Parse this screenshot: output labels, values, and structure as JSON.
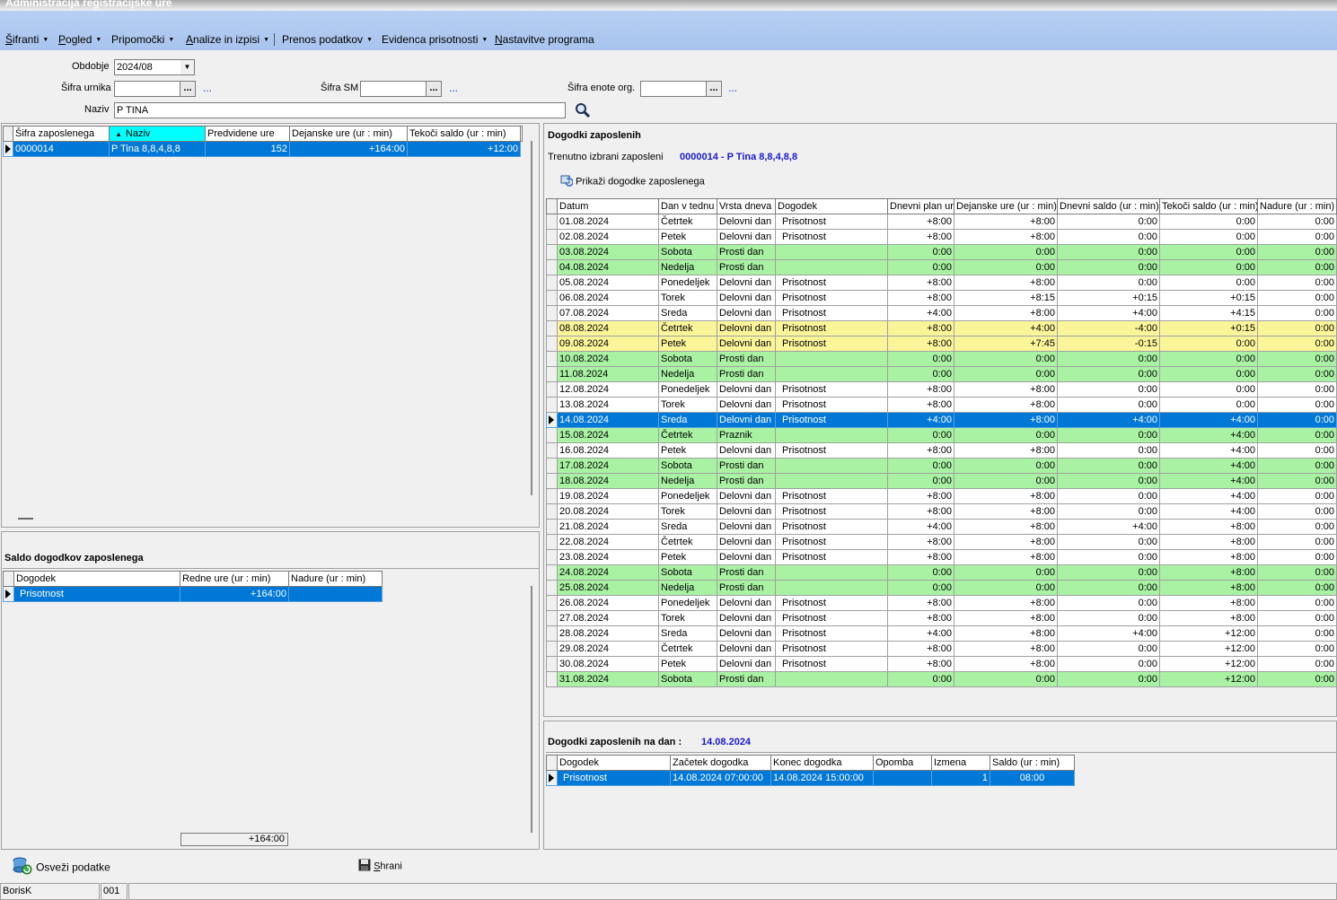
{
  "window": {
    "title": "Administracija registracijske ure"
  },
  "menu": [
    {
      "label": "Šifranti",
      "underline": "Š",
      "rest": "ifranti",
      "dropdown": true
    },
    {
      "label": "Pogled",
      "underline": "P",
      "rest": "ogled",
      "dropdown": true
    },
    {
      "label": "Pripomočki",
      "underline": "",
      "rest": "Pripomočki",
      "dropdown": true
    },
    {
      "label": "Analize in izpisi",
      "underline": "A",
      "rest": "nalize in izpisi",
      "dropdown": true
    },
    {
      "label": "Prenos podatkov",
      "underline": "",
      "rest": "Prenos podatkov",
      "dropdown": true
    },
    {
      "label": "Evidenca prisotnosti",
      "underline": "",
      "rest": "Evidenca prisotnosti",
      "dropdown": true
    },
    {
      "label": "Nastavitve programa",
      "underline": "N",
      "rest": "astavitve programa",
      "dropdown": false
    }
  ],
  "filters": {
    "obdobje_label": "Obdobje",
    "obdobje_value": "2024/08",
    "sifra_urnika_label": "Šifra urnika",
    "sifra_urnika_value": "",
    "sifra_sm_label": "Šifra SM",
    "sifra_sm_value": "",
    "sifra_enote_label": "Šifra enote org.",
    "sifra_enote_value": "",
    "naziv_label": "Naziv",
    "naziv_value": "P TINA",
    "ellipsis": "...",
    "more": "..."
  },
  "employees": {
    "columns": [
      "Šifra zaposlenega",
      "Naziv",
      "Predvidene ure",
      "Dejanske ure (ur : min)",
      "Tekoči saldo (ur : min)"
    ],
    "rows": [
      {
        "sifra": "0000014",
        "naziv": "P Tina 8,8,4,8,8",
        "predvidene": "152",
        "dejanske": "+164:00",
        "saldo": "+12:00"
      }
    ]
  },
  "saldo": {
    "title": "Saldo dogodkov zaposlenega",
    "columns": [
      "Dogodek",
      "Redne ure (ur : min)",
      "Nadure (ur : min)"
    ],
    "rows": [
      {
        "dogodek": "Prisotnost",
        "redne": "+164:00",
        "nadure": ""
      }
    ],
    "total": "+164:00"
  },
  "events": {
    "title": "Dogodki zaposlenih",
    "current_label": "Trenutno izbrani zaposleni",
    "current_value": "0000014 - P Tina 8,8,4,8,8",
    "show_button": "Prikaži dogodke zaposlenega",
    "columns": [
      "Datum",
      "Dan v tednu",
      "Vrsta dneva",
      "Dogodek",
      "Dnevni plan ur",
      "Dejanske ure (ur : min)",
      "Dnevni saldo (ur : min)",
      "Tekoči saldo (ur : min)",
      "Nadure (ur : min)"
    ],
    "rows": [
      {
        "datum": "01.08.2024",
        "dan": "Četrtek",
        "vrsta": "Delovni dan",
        "dogodek": "Prisotnost",
        "plan": "+8:00",
        "dejanske": "+8:00",
        "dnevni": "0:00",
        "tekoci": "0:00",
        "nadure": "0:00",
        "color": "white"
      },
      {
        "datum": "02.08.2024",
        "dan": "Petek",
        "vrsta": "Delovni dan",
        "dogodek": "Prisotnost",
        "plan": "+8:00",
        "dejanske": "+8:00",
        "dnevni": "0:00",
        "tekoci": "0:00",
        "nadure": "0:00",
        "color": "white"
      },
      {
        "datum": "03.08.2024",
        "dan": "Sobota",
        "vrsta": "Prosti dan",
        "dogodek": "",
        "plan": "0:00",
        "dejanske": "0:00",
        "dnevni": "0:00",
        "tekoci": "0:00",
        "nadure": "0:00",
        "color": "green"
      },
      {
        "datum": "04.08.2024",
        "dan": "Nedelja",
        "vrsta": "Prosti dan",
        "dogodek": "",
        "plan": "0:00",
        "dejanske": "0:00",
        "dnevni": "0:00",
        "tekoci": "0:00",
        "nadure": "0:00",
        "color": "green"
      },
      {
        "datum": "05.08.2024",
        "dan": "Ponedeljek",
        "vrsta": "Delovni dan",
        "dogodek": "Prisotnost",
        "plan": "+8:00",
        "dejanske": "+8:00",
        "dnevni": "0:00",
        "tekoci": "0:00",
        "nadure": "0:00",
        "color": "white"
      },
      {
        "datum": "06.08.2024",
        "dan": "Torek",
        "vrsta": "Delovni dan",
        "dogodek": "Prisotnost",
        "plan": "+8:00",
        "dejanske": "+8:15",
        "dnevni": "+0:15",
        "tekoci": "+0:15",
        "nadure": "0:00",
        "color": "white"
      },
      {
        "datum": "07.08.2024",
        "dan": "Sreda",
        "vrsta": "Delovni dan",
        "dogodek": "Prisotnost",
        "plan": "+4:00",
        "dejanske": "+8:00",
        "dnevni": "+4:00",
        "tekoci": "+4:15",
        "nadure": "0:00",
        "color": "white"
      },
      {
        "datum": "08.08.2024",
        "dan": "Četrtek",
        "vrsta": "Delovni dan",
        "dogodek": "Prisotnost",
        "plan": "+8:00",
        "dejanske": "+4:00",
        "dnevni": "-4:00",
        "tekoci": "+0:15",
        "nadure": "0:00",
        "color": "yellow"
      },
      {
        "datum": "09.08.2024",
        "dan": "Petek",
        "vrsta": "Delovni dan",
        "dogodek": "Prisotnost",
        "plan": "+8:00",
        "dejanske": "+7:45",
        "dnevni": "-0:15",
        "tekoci": "0:00",
        "nadure": "0:00",
        "color": "yellow"
      },
      {
        "datum": "10.08.2024",
        "dan": "Sobota",
        "vrsta": "Prosti dan",
        "dogodek": "",
        "plan": "0:00",
        "dejanske": "0:00",
        "dnevni": "0:00",
        "tekoci": "0:00",
        "nadure": "0:00",
        "color": "green"
      },
      {
        "datum": "11.08.2024",
        "dan": "Nedelja",
        "vrsta": "Prosti dan",
        "dogodek": "",
        "plan": "0:00",
        "dejanske": "0:00",
        "dnevni": "0:00",
        "tekoci": "0:00",
        "nadure": "0:00",
        "color": "green"
      },
      {
        "datum": "12.08.2024",
        "dan": "Ponedeljek",
        "vrsta": "Delovni dan",
        "dogodek": "Prisotnost",
        "plan": "+8:00",
        "dejanske": "+8:00",
        "dnevni": "0:00",
        "tekoci": "0:00",
        "nadure": "0:00",
        "color": "white"
      },
      {
        "datum": "13.08.2024",
        "dan": "Torek",
        "vrsta": "Delovni dan",
        "dogodek": "Prisotnost",
        "plan": "+8:00",
        "dejanske": "+8:00",
        "dnevni": "0:00",
        "tekoci": "0:00",
        "nadure": "0:00",
        "color": "white"
      },
      {
        "datum": "14.08.2024",
        "dan": "Sreda",
        "vrsta": "Delovni dan",
        "dogodek": "Prisotnost",
        "plan": "+4:00",
        "dejanske": "+8:00",
        "dnevni": "+4:00",
        "tekoci": "+4:00",
        "nadure": "0:00",
        "color": "sel"
      },
      {
        "datum": "15.08.2024",
        "dan": "Četrtek",
        "vrsta": "Praznik",
        "dogodek": "",
        "plan": "0:00",
        "dejanske": "0:00",
        "dnevni": "0:00",
        "tekoci": "+4:00",
        "nadure": "0:00",
        "color": "green"
      },
      {
        "datum": "16.08.2024",
        "dan": "Petek",
        "vrsta": "Delovni dan",
        "dogodek": "Prisotnost",
        "plan": "+8:00",
        "dejanske": "+8:00",
        "dnevni": "0:00",
        "tekoci": "+4:00",
        "nadure": "0:00",
        "color": "white"
      },
      {
        "datum": "17.08.2024",
        "dan": "Sobota",
        "vrsta": "Prosti dan",
        "dogodek": "",
        "plan": "0:00",
        "dejanske": "0:00",
        "dnevni": "0:00",
        "tekoci": "+4:00",
        "nadure": "0:00",
        "color": "green"
      },
      {
        "datum": "18.08.2024",
        "dan": "Nedelja",
        "vrsta": "Prosti dan",
        "dogodek": "",
        "plan": "0:00",
        "dejanske": "0:00",
        "dnevni": "0:00",
        "tekoci": "+4:00",
        "nadure": "0:00",
        "color": "green"
      },
      {
        "datum": "19.08.2024",
        "dan": "Ponedeljek",
        "vrsta": "Delovni dan",
        "dogodek": "Prisotnost",
        "plan": "+8:00",
        "dejanske": "+8:00",
        "dnevni": "0:00",
        "tekoci": "+4:00",
        "nadure": "0:00",
        "color": "white"
      },
      {
        "datum": "20.08.2024",
        "dan": "Torek",
        "vrsta": "Delovni dan",
        "dogodek": "Prisotnost",
        "plan": "+8:00",
        "dejanske": "+8:00",
        "dnevni": "0:00",
        "tekoci": "+4:00",
        "nadure": "0:00",
        "color": "white"
      },
      {
        "datum": "21.08.2024",
        "dan": "Sreda",
        "vrsta": "Delovni dan",
        "dogodek": "Prisotnost",
        "plan": "+4:00",
        "dejanske": "+8:00",
        "dnevni": "+4:00",
        "tekoci": "+8:00",
        "nadure": "0:00",
        "color": "white"
      },
      {
        "datum": "22.08.2024",
        "dan": "Četrtek",
        "vrsta": "Delovni dan",
        "dogodek": "Prisotnost",
        "plan": "+8:00",
        "dejanske": "+8:00",
        "dnevni": "0:00",
        "tekoci": "+8:00",
        "nadure": "0:00",
        "color": "white"
      },
      {
        "datum": "23.08.2024",
        "dan": "Petek",
        "vrsta": "Delovni dan",
        "dogodek": "Prisotnost",
        "plan": "+8:00",
        "dejanske": "+8:00",
        "dnevni": "0:00",
        "tekoci": "+8:00",
        "nadure": "0:00",
        "color": "white"
      },
      {
        "datum": "24.08.2024",
        "dan": "Sobota",
        "vrsta": "Prosti dan",
        "dogodek": "",
        "plan": "0:00",
        "dejanske": "0:00",
        "dnevni": "0:00",
        "tekoci": "+8:00",
        "nadure": "0:00",
        "color": "green"
      },
      {
        "datum": "25.08.2024",
        "dan": "Nedelja",
        "vrsta": "Prosti dan",
        "dogodek": "",
        "plan": "0:00",
        "dejanske": "0:00",
        "dnevni": "0:00",
        "tekoci": "+8:00",
        "nadure": "0:00",
        "color": "green"
      },
      {
        "datum": "26.08.2024",
        "dan": "Ponedeljek",
        "vrsta": "Delovni dan",
        "dogodek": "Prisotnost",
        "plan": "+8:00",
        "dejanske": "+8:00",
        "dnevni": "0:00",
        "tekoci": "+8:00",
        "nadure": "0:00",
        "color": "white"
      },
      {
        "datum": "27.08.2024",
        "dan": "Torek",
        "vrsta": "Delovni dan",
        "dogodek": "Prisotnost",
        "plan": "+8:00",
        "dejanske": "+8:00",
        "dnevni": "0:00",
        "tekoci": "+8:00",
        "nadure": "0:00",
        "color": "white"
      },
      {
        "datum": "28.08.2024",
        "dan": "Sreda",
        "vrsta": "Delovni dan",
        "dogodek": "Prisotnost",
        "plan": "+4:00",
        "dejanske": "+8:00",
        "dnevni": "+4:00",
        "tekoci": "+12:00",
        "nadure": "0:00",
        "color": "white"
      },
      {
        "datum": "29.08.2024",
        "dan": "Četrtek",
        "vrsta": "Delovni dan",
        "dogodek": "Prisotnost",
        "plan": "+8:00",
        "dejanske": "+8:00",
        "dnevni": "0:00",
        "tekoci": "+12:00",
        "nadure": "0:00",
        "color": "white"
      },
      {
        "datum": "30.08.2024",
        "dan": "Petek",
        "vrsta": "Delovni dan",
        "dogodek": "Prisotnost",
        "plan": "+8:00",
        "dejanske": "+8:00",
        "dnevni": "0:00",
        "tekoci": "+12:00",
        "nadure": "0:00",
        "color": "white"
      },
      {
        "datum": "31.08.2024",
        "dan": "Sobota",
        "vrsta": "Prosti dan",
        "dogodek": "",
        "plan": "0:00",
        "dejanske": "0:00",
        "dnevni": "0:00",
        "tekoci": "+12:00",
        "nadure": "0:00",
        "color": "green"
      }
    ]
  },
  "day_events": {
    "title": "Dogodki zaposlenih na dan :",
    "date": "14.08.2024",
    "columns": [
      "Dogodek",
      "Začetek dogodka",
      "Konec dogodka",
      "Opomba",
      "Izmena",
      "Saldo (ur : min)"
    ],
    "rows": [
      {
        "dogodek": "Prisotnost",
        "zacetek": "14.08.2024 07:00:00",
        "konec": "14.08.2024 15:00:00",
        "opomba": "",
        "izmena": "1",
        "saldo": "08:00"
      }
    ]
  },
  "footer": {
    "refresh_button": "Osveži podatke",
    "save_button": "Shrani",
    "save_underline": "S",
    "save_rest": "hrani"
  },
  "statusbar": {
    "user": "BorisK",
    "code": "001",
    "extra": ""
  },
  "colors": {
    "menubar": "#a8c4ee",
    "selection": "#0078d7",
    "green_row": "#a9f2a4",
    "yellow_row": "#fbf59a",
    "accent_text": "#1a1acc",
    "sort_header": "#00ffff"
  }
}
